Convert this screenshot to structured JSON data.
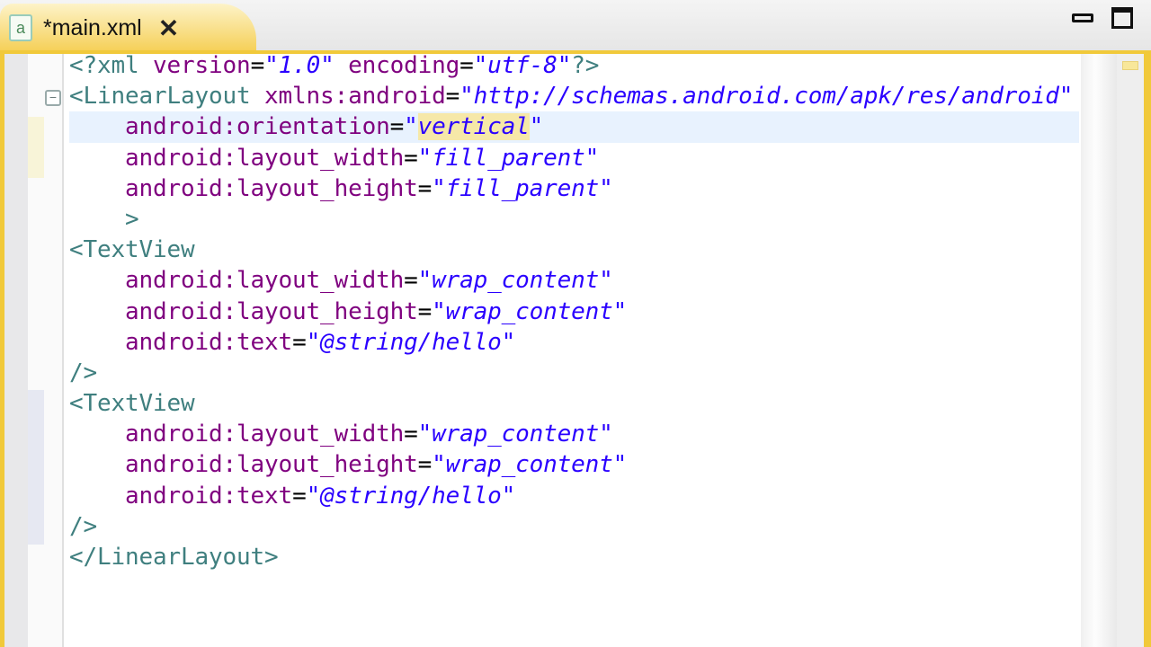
{
  "tab": {
    "title": "*main.xml",
    "close_icon": "close-icon",
    "file_icon": "xml-file-icon"
  },
  "window": {
    "minimize": "minimize-icon",
    "maximize": "maximize-icon"
  },
  "colors": {
    "tag": "#3f7f7f",
    "attr": "#7f007f",
    "value": "#2a00ff",
    "accent": "#f1c93a"
  },
  "code": [
    [
      [
        "t",
        "<?xml "
      ],
      [
        "a",
        "version"
      ],
      [
        "p",
        "="
      ],
      [
        "v",
        "\"1.0\""
      ],
      [
        "p",
        " "
      ],
      [
        "a",
        "encoding"
      ],
      [
        "p",
        "="
      ],
      [
        "v",
        "\"utf-8\""
      ],
      [
        "t",
        "?>"
      ]
    ],
    [
      [
        "t",
        "<LinearLayout "
      ],
      [
        "a",
        "xmlns:android"
      ],
      [
        "p",
        "="
      ],
      [
        "v",
        "\"http://schemas.android.com/apk/res/android\""
      ]
    ],
    [
      [
        "p",
        "    "
      ],
      [
        "a",
        "android:orientation"
      ],
      [
        "p",
        "="
      ],
      [
        "v",
        "\""
      ],
      [
        "hl",
        "vertical"
      ],
      [
        "v",
        "\""
      ]
    ],
    [
      [
        "p",
        "    "
      ],
      [
        "a",
        "android:layout_width"
      ],
      [
        "p",
        "="
      ],
      [
        "v",
        "\"fill_parent\""
      ]
    ],
    [
      [
        "p",
        "    "
      ],
      [
        "a",
        "android:layout_height"
      ],
      [
        "p",
        "="
      ],
      [
        "v",
        "\"fill_parent\""
      ]
    ],
    [
      [
        "p",
        "    "
      ],
      [
        "t",
        ">"
      ]
    ],
    [
      [
        "t",
        "<TextView"
      ]
    ],
    [
      [
        "p",
        "    "
      ],
      [
        "a",
        "android:layout_width"
      ],
      [
        "p",
        "="
      ],
      [
        "v",
        "\"wrap_content\""
      ]
    ],
    [
      [
        "p",
        "    "
      ],
      [
        "a",
        "android:layout_height"
      ],
      [
        "p",
        "="
      ],
      [
        "v",
        "\"wrap_content\""
      ]
    ],
    [
      [
        "p",
        "    "
      ],
      [
        "a",
        "android:text"
      ],
      [
        "p",
        "="
      ],
      [
        "v",
        "\"@string/hello\""
      ]
    ],
    [
      [
        "t",
        "/>"
      ]
    ],
    [
      [
        "t",
        "<TextView"
      ]
    ],
    [
      [
        "p",
        "    "
      ],
      [
        "a",
        "android:layout_width"
      ],
      [
        "p",
        "="
      ],
      [
        "v",
        "\"wrap_content\""
      ]
    ],
    [
      [
        "p",
        "    "
      ],
      [
        "a",
        "android:layout_height"
      ],
      [
        "p",
        "="
      ],
      [
        "v",
        "\"wrap_content\""
      ]
    ],
    [
      [
        "p",
        "    "
      ],
      [
        "a",
        "android:text"
      ],
      [
        "p",
        "="
      ],
      [
        "v",
        "\"@string/hello\""
      ]
    ],
    [
      [
        "t",
        "/>"
      ]
    ],
    [
      [
        "t",
        "</LinearLayout>"
      ]
    ]
  ]
}
